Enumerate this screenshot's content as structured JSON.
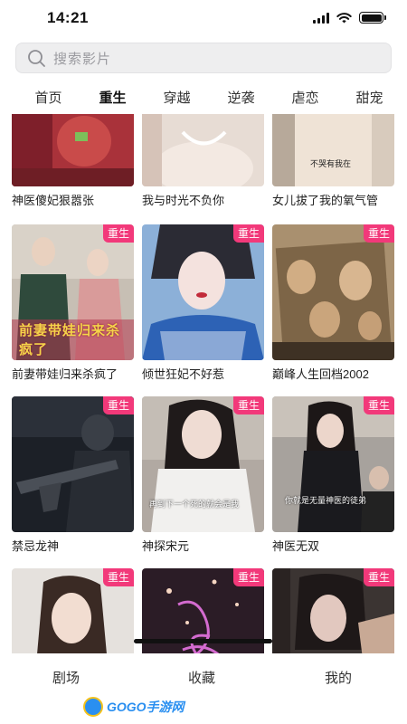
{
  "status_bar": {
    "time": "14:21"
  },
  "search": {
    "placeholder": "搜索影片"
  },
  "tabs": [
    "首页",
    "重生",
    "穿越",
    "逆袭",
    "虐恋",
    "甜宠"
  ],
  "active_tab": "重生",
  "grid": {
    "row1": [
      {
        "title": "神医傻妃狠嚣张",
        "poster_caption": ""
      },
      {
        "title": "我与时光不负你",
        "poster_caption": ""
      },
      {
        "title": "女儿拔了我的氧气管",
        "poster_caption": "不哭有我在"
      }
    ],
    "row2": [
      {
        "title": "前妻带娃归来杀疯了",
        "badge": "重生",
        "poster_caption": "前妻带娃归来杀疯了"
      },
      {
        "title": "倾世狂妃不好惹",
        "badge": "重生"
      },
      {
        "title": "巅峰人生回档2002",
        "badge": "重生"
      }
    ],
    "row3": [
      {
        "title": "禁忌龙神",
        "badge": "重生"
      },
      {
        "title": "神探宋元",
        "badge": "重生",
        "poster_caption": "再到下一个死的就会是我"
      },
      {
        "title": "神医无双",
        "badge": "重生",
        "poster_caption": "你就是无量神医的徒弟"
      }
    ],
    "row4": [
      {
        "badge": "重生"
      },
      {
        "badge": "重生"
      },
      {
        "badge": "重生"
      }
    ]
  },
  "bottom_nav": [
    "剧场",
    "收藏",
    "我的"
  ],
  "watermark": "GOGO手游网",
  "colors": {
    "badge": "#f2397a",
    "accent": "#2a8ff0"
  }
}
